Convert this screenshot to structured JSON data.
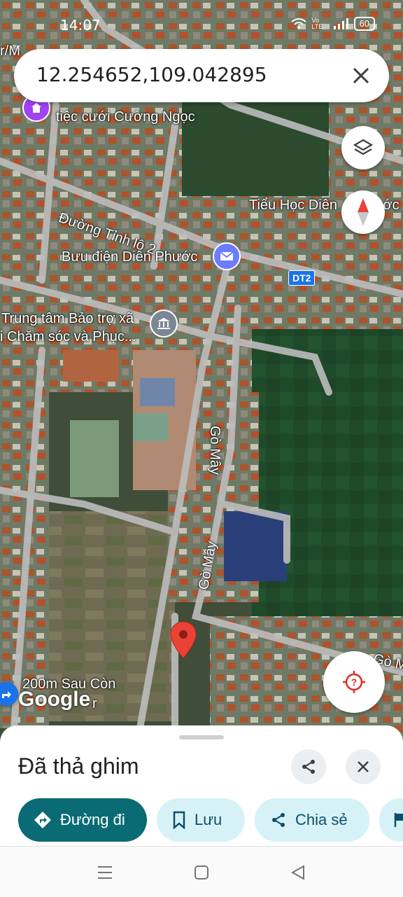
{
  "status": {
    "time": "14:07",
    "battery": "60",
    "network": "Vo LTE"
  },
  "search": {
    "query": "12.254652,109.042895"
  },
  "map": {
    "labels": {
      "wedding": "tiệc cưới Cường Ngọc",
      "road_dt2": "Đường Tỉnh lộ 2",
      "school": "Tiểu Học Diên ",
      "school_tail": "ớc",
      "post_office": "Bưu điện Diên Phước",
      "center_line1": "Trung tâm Bảo trợ xã",
      "center_line2": "i Chăm sóc và Phục...",
      "go_may_1": "Gò Mây",
      "go_may_2": "Gò Mây",
      "go_may_3": "Gò M",
      "top_left": "r/M",
      "bottom_left_1": "200m Sau Còn",
      "bottom_left_2": "r",
      "shield": "DT2"
    },
    "google_logo": "Google"
  },
  "sheet": {
    "title": "Đã thả ghim",
    "directions_label": "Đường đi",
    "save_label": "Lưu",
    "share_label": "Chia sẻ"
  },
  "colors": {
    "primary_chip": "#0b6b74",
    "secondary_chip": "#d7f2f7",
    "pin": "#ea4335"
  },
  "icons": [
    "share-icon",
    "close-icon",
    "directions-icon",
    "bookmark-icon",
    "flag-icon",
    "layers-icon",
    "compass-icon",
    "location-icon"
  ]
}
